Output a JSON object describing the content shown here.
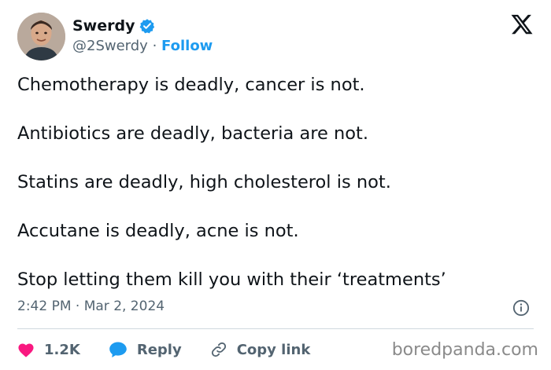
{
  "author": {
    "display_name": "Swerdy",
    "handle": "@2Swerdy",
    "separator": "·",
    "follow_label": "Follow",
    "verified_icon": "verified-badge-icon",
    "avatar": "profile-avatar"
  },
  "platform_logo": "x-logo",
  "tweet": {
    "lines": [
      "Chemotherapy is deadly, cancer is not.",
      "Antibiotics are deadly, bacteria are not.",
      "Statins are deadly, high cholesterol is not.",
      "Accutane is deadly, acne is not.",
      "Stop letting them kill you with their ‘treatments’"
    ],
    "timestamp": "2:42 PM · Mar 2, 2024"
  },
  "actions": {
    "like_count": "1.2K",
    "reply_label": "Reply",
    "copy_link_label": "Copy link"
  },
  "watermark": "boredpanda.com",
  "colors": {
    "accent": "#1d9bf0",
    "like": "#f91880",
    "muted": "#536471",
    "text": "#0f1419"
  }
}
